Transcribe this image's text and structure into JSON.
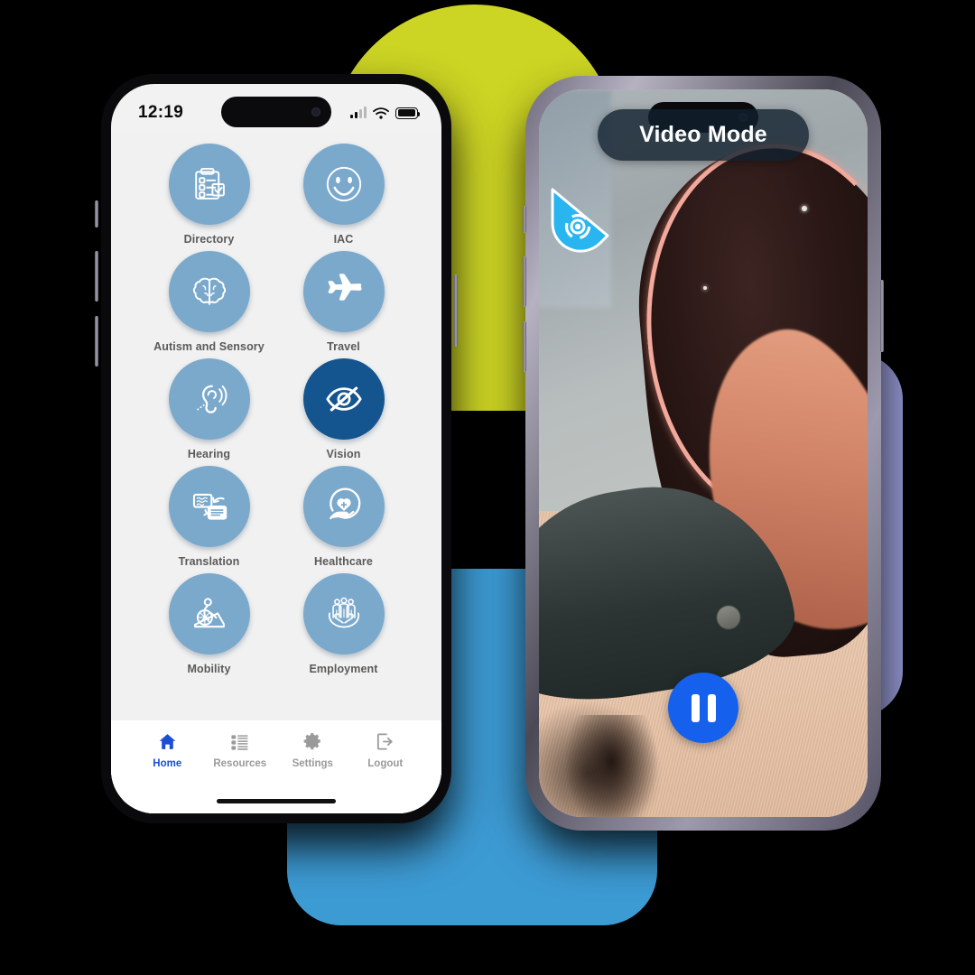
{
  "background": {
    "canvas_color": "#000000",
    "shapes": [
      {
        "name": "yellow-arch",
        "color": "#ccd424"
      },
      {
        "name": "blue-rounded-rect",
        "color": "#3d9bd4"
      },
      {
        "name": "purple-rounded-rect",
        "color": "#9094cc"
      }
    ]
  },
  "left_phone": {
    "status_bar": {
      "time": "12:19",
      "signal_icon": "cellular-signal-icon",
      "wifi_icon": "wifi-icon",
      "battery_icon": "battery-full-icon"
    },
    "accent_color": "#7aa9cc",
    "active_color": "#14548f",
    "grid": [
      {
        "label": "Directory",
        "icon": "clipboard-checklist-icon",
        "active": false
      },
      {
        "label": "IAC",
        "icon": "smiley-face-icon",
        "active": false
      },
      {
        "label": "Autism and Sensory",
        "icon": "brain-icon",
        "active": false
      },
      {
        "label": "Travel",
        "icon": "airplane-icon",
        "active": false
      },
      {
        "label": "Hearing",
        "icon": "ear-hearing-icon",
        "active": false
      },
      {
        "label": "Vision",
        "icon": "eye-slash-icon",
        "active": true
      },
      {
        "label": "Translation",
        "icon": "translate-exchange-icon",
        "active": false
      },
      {
        "label": "Healthcare",
        "icon": "hand-heart-cross-icon",
        "active": false
      },
      {
        "label": "Mobility",
        "icon": "wheelchair-ramp-icon",
        "active": false
      },
      {
        "label": "Employment",
        "icon": "hands-people-icon",
        "active": false
      }
    ],
    "tab_bar": {
      "active_color": "#1b4ed8",
      "tabs": [
        {
          "label": "Home",
          "icon": "home-icon",
          "active": true
        },
        {
          "label": "Resources",
          "icon": "list-icon",
          "active": false
        },
        {
          "label": "Settings",
          "icon": "gear-icon",
          "active": false
        },
        {
          "label": "Logout",
          "icon": "sign-out-icon",
          "active": false
        }
      ]
    }
  },
  "right_phone": {
    "mode_label": "Video Mode",
    "mode_pill_color": "#10202e",
    "drop_badge_icon": "water-drop-target-icon",
    "drop_badge_color": "#29b6f0",
    "pause_button": {
      "icon": "pause-icon",
      "color": "#1560ec"
    },
    "video_scene": "dark mug with pink rim, finger, pan and beige carpet"
  }
}
